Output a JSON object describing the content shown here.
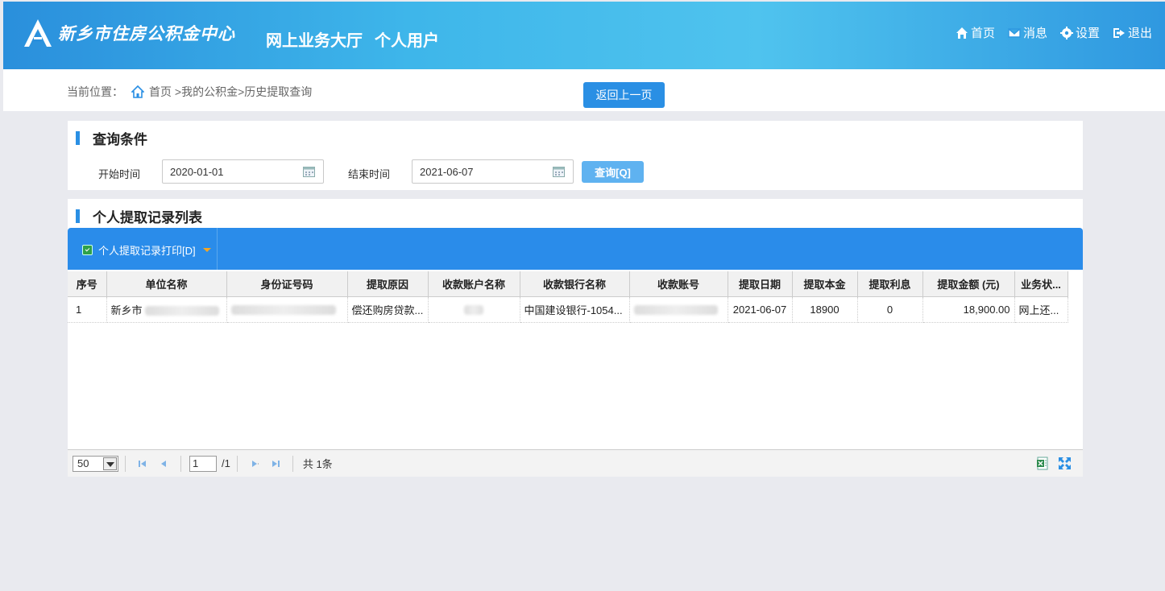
{
  "header": {
    "site_name": "新乡市住房公积金中心",
    "hall": "网上业务大厅",
    "user_type": "个人用户",
    "nav": [
      {
        "label": "首页",
        "icon": "home-icon"
      },
      {
        "label": "消息",
        "icon": "mail-icon"
      },
      {
        "label": "设置",
        "icon": "gear-icon"
      },
      {
        "label": "退出",
        "icon": "logout-icon"
      }
    ]
  },
  "breadcrumb": {
    "prefix": "当前位置：",
    "path": "首页 >我的公积金>历史提取查询",
    "back_label": "返回上一页"
  },
  "query": {
    "title": "查询条件",
    "start_label": "开始时间",
    "start_value": "2020-01-01",
    "end_label": "结束时间",
    "end_value": "2021-06-07",
    "search_label": "查询[Q]"
  },
  "list": {
    "title": "个人提取记录列表",
    "print_label": "个人提取记录打印[D]",
    "columns": [
      "序号",
      "单位名称",
      "身份证号码",
      "提取原因",
      "收款账户名称",
      "收款银行名称",
      "收款账号",
      "提取日期",
      "提取本金",
      "提取利息",
      "提取金额 (元)",
      "业务状..."
    ],
    "rows": [
      {
        "no": "1",
        "unit": "新乡市",
        "reason": "偿还购房贷款...",
        "bank": "中国建设银行-1054...",
        "date": "2021-06-07",
        "principal": "18900",
        "interest": "0",
        "amount": "18,900.00",
        "status": "网上还..."
      }
    ]
  },
  "pager": {
    "page_size": "50",
    "current_page": "1",
    "total_pages": "/1",
    "total_count": "共 1条"
  },
  "colors": {
    "header_blue": "#2a8fdc",
    "accent_blue": "#2a8fe4",
    "toolbar_blue": "#2a8cea",
    "search_button": "#5fb2f0"
  }
}
